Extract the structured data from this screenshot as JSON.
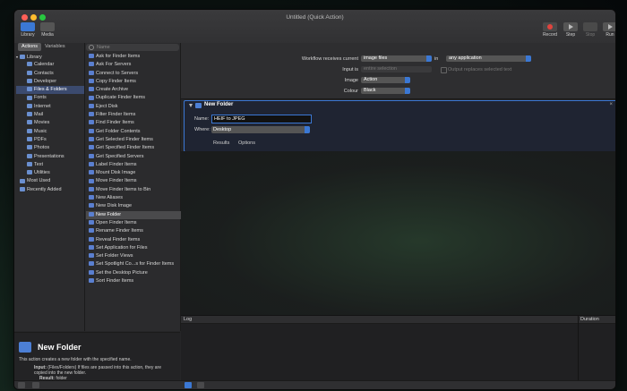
{
  "window": {
    "title": "Untitled (Quick Action)"
  },
  "toolbar": {
    "library_label": "Library",
    "media_label": "Media",
    "record_label": "Record",
    "step_label": "Step",
    "stop_label": "Stop",
    "run_label": "Run"
  },
  "tabs": {
    "actions": "Actions",
    "variables": "Variables"
  },
  "search": {
    "placeholder": "Name"
  },
  "library": {
    "items": [
      "Library",
      "Calendar",
      "Contacts",
      "Developer",
      "Files & Folders",
      "Fonts",
      "Internet",
      "Mail",
      "Movies",
      "Music",
      "PDFs",
      "Photos",
      "Presentations",
      "Text",
      "Utilities",
      "Most Used",
      "Recently Added"
    ]
  },
  "actions": {
    "items": [
      "Ask for Finder Items",
      "Ask For Servers",
      "Connect to Servers",
      "Copy Finder Items",
      "Create Archive",
      "Duplicate Finder Items",
      "Eject Disk",
      "Filter Finder Items",
      "Find Finder Items",
      "Get Folder Contents",
      "Get Selected Finder Items",
      "Get Specified Finder Items",
      "Get Specified Servers",
      "Label Finder Items",
      "Mount Disk Image",
      "Move Finder Items",
      "Move Finder Items to Bin",
      "New Aliases",
      "New Disk Image",
      "New Folder",
      "Open Finder Items",
      "Rename Finder Items",
      "Reveal Finder Items",
      "Set Application for Files",
      "Set Folder Views",
      "Set Spotlight Co...s for Finder Items",
      "Set the Desktop Picture",
      "Sort Finder Items"
    ]
  },
  "description": {
    "title": "New Folder",
    "text": "This action creates a new folder with the specified name.",
    "input_label": "Input:",
    "input_text": "(Files/Folders) If files are passed into this action, they are copied into the new folder.",
    "result_label": "Result:",
    "result_text": "folder"
  },
  "workflow": {
    "receives_label": "Workflow receives current",
    "receives_value": "image files",
    "in_label": "in",
    "in_value": "any application",
    "input_is_label": "Input is",
    "input_is_value": "entire selection",
    "output_label": "Output replaces selected text",
    "image_label": "Image",
    "image_value": "Action",
    "colour_label": "Colour",
    "colour_value": "Black"
  },
  "action_card": {
    "title": "New Folder",
    "name_label": "Name:",
    "name_value": "HEIF to JPEG",
    "where_label": "Where:",
    "where_value": "Desktop",
    "tab_results": "Results",
    "tab_options": "Options"
  },
  "log": {
    "log_label": "Log",
    "duration_label": "Duration"
  },
  "colors": {
    "accent": "#3b78d4",
    "selection": "#3b4a6e"
  }
}
